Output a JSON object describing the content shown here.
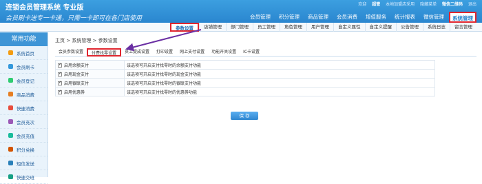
{
  "brand": {
    "title": "连锁会员管理系统 专业版",
    "slogan": "会员刷卡送专一卡通，只需一卡即可在各门店使用"
  },
  "toplinks": {
    "welcome": "欢迎",
    "user": "超管",
    "role": "本地加盟店采用",
    "logout": "隐藏菜单",
    "scan": "微信二维码",
    "help": "退出"
  },
  "mainnav": [
    "会员管理",
    "积分管理",
    "商品管理",
    "会员消费",
    "增值服务",
    "统计报表",
    "微信管理",
    "系统管理"
  ],
  "subnav": [
    "参数设置",
    "店铺管理",
    "部门管理",
    "员工管理",
    "角色管理",
    "用户管理",
    "自定义属性",
    "自定义提醒",
    "公告管理",
    "系统日志",
    "留言管理"
  ],
  "sidebar": {
    "title": "常用功能",
    "items": [
      "系统首页",
      "会员刷卡",
      "会员登记",
      "商品消费",
      "快速消费",
      "会员充次",
      "会员充值",
      "积分兑换",
      "短信发送",
      "快速交班"
    ]
  },
  "crumb": {
    "home": "主页",
    "sys": "系统管理",
    "param": "参数设置"
  },
  "tabs": [
    "会员参数设置",
    "付费找零设置",
    "员工提成设置",
    "打印设置",
    "网上支付设置",
    "功能开关设置",
    "IC卡设置"
  ],
  "rows": [
    {
      "name": "启用余额支付",
      "desc": "该选项可开启支付找零时的余额支付功能"
    },
    {
      "name": "启用现金支付",
      "desc": "该选项可开启支付找零时的现金支付功能"
    },
    {
      "name": "启用银联支付",
      "desc": "该选项可开启支付找零时的银联支付功能"
    },
    {
      "name": "启用优惠券",
      "desc": "该选项可开启支付找零时的优惠券功能"
    }
  ],
  "save_label": "保 存"
}
